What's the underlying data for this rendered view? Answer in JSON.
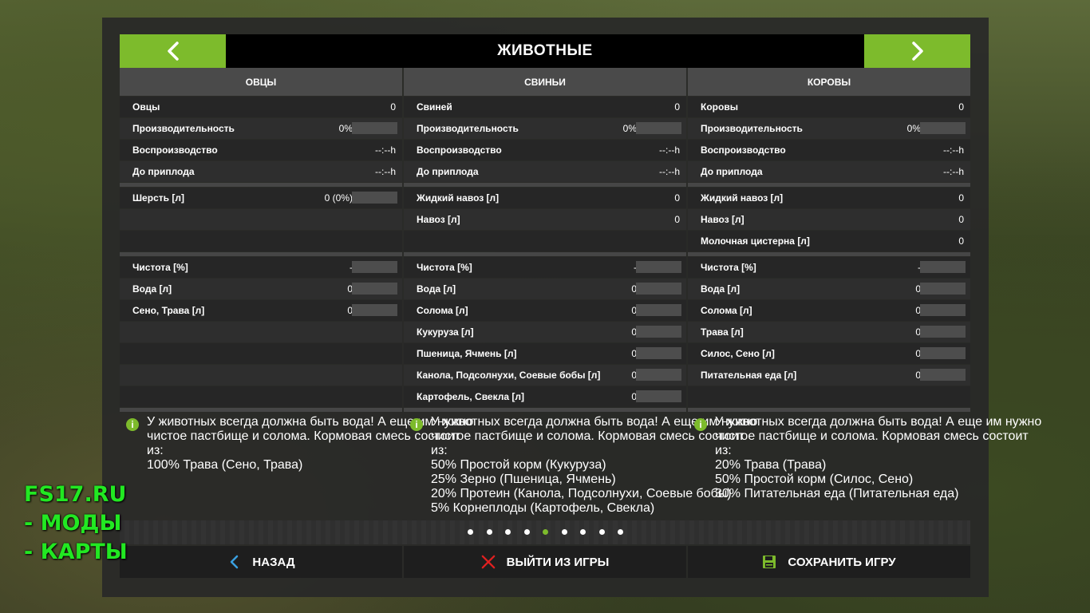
{
  "header": {
    "title": "ЖИВОТНЫЕ"
  },
  "columns": [
    {
      "name": "ОВЦЫ",
      "stats": [
        {
          "label": "Овцы",
          "value": "0",
          "bar": false
        },
        {
          "label": "Производительность",
          "value": "0%",
          "bar": true
        },
        {
          "label": "Воспроизводство",
          "value": "--:--h",
          "bar": false
        },
        {
          "label": "До приплода",
          "value": "--:--h",
          "bar": false
        }
      ],
      "products": [
        {
          "label": "Шерсть [л]",
          "value": "0 (0%)",
          "bar": true
        },
        {
          "label": "",
          "value": "",
          "bar": false
        },
        {
          "label": "",
          "value": "",
          "bar": false
        }
      ],
      "needs": [
        {
          "label": "Чистота [%]",
          "value": "-",
          "bar": true
        },
        {
          "label": "Вода [л]",
          "value": "0",
          "bar": true
        },
        {
          "label": "Сено, Трава [л]",
          "value": "0",
          "bar": true
        },
        {
          "label": "",
          "value": "",
          "bar": false
        },
        {
          "label": "",
          "value": "",
          "bar": false
        },
        {
          "label": "",
          "value": "",
          "bar": false
        },
        {
          "label": "",
          "value": "",
          "bar": false
        }
      ],
      "info": [
        "У животных всегда должна быть вода! А еще им нужно",
        "чистое пастбище и солома. Кормовая смесь состоит",
        "из:",
        "100% Трава (Сено, Трава)"
      ]
    },
    {
      "name": "СВИНЬИ",
      "stats": [
        {
          "label": "Свиней",
          "value": "0",
          "bar": false
        },
        {
          "label": "Производительность",
          "value": "0%",
          "bar": true
        },
        {
          "label": "Воспроизводство",
          "value": "--:--h",
          "bar": false
        },
        {
          "label": "До приплода",
          "value": "--:--h",
          "bar": false
        }
      ],
      "products": [
        {
          "label": "Жидкий навоз [л]",
          "value": "0",
          "bar": false
        },
        {
          "label": "Навоз [л]",
          "value": "0",
          "bar": false
        },
        {
          "label": "",
          "value": "",
          "bar": false
        }
      ],
      "needs": [
        {
          "label": "Чистота [%]",
          "value": "-",
          "bar": true
        },
        {
          "label": "Вода [л]",
          "value": "0",
          "bar": true
        },
        {
          "label": "Солома [л]",
          "value": "0",
          "bar": true
        },
        {
          "label": "Кукуруза [л]",
          "value": "0",
          "bar": true
        },
        {
          "label": "Пшеница, Ячмень [л]",
          "value": "0",
          "bar": true
        },
        {
          "label": "Канола, Подсолнухи, Соевые бобы [л]",
          "value": "0",
          "bar": true
        },
        {
          "label": "Картофель, Свекла [л]",
          "value": "0",
          "bar": true
        }
      ],
      "info": [
        "У животных всегда должна быть вода! А еще им нужно",
        "чистое пастбище и солома. Кормовая смесь состоит",
        "из:",
        "50% Простой корм (Кукуруза)",
        "25% Зерно (Пшеница, Ячмень)",
        "20% Протеин (Канола, Подсолнухи, Соевые бобы)",
        "5% Корнеплоды (Картофель, Свекла)"
      ]
    },
    {
      "name": "КОРОВЫ",
      "stats": [
        {
          "label": "Коровы",
          "value": "0",
          "bar": false
        },
        {
          "label": "Производительность",
          "value": "0%",
          "bar": true
        },
        {
          "label": "Воспроизводство",
          "value": "--:--h",
          "bar": false
        },
        {
          "label": "До приплода",
          "value": "--:--h",
          "bar": false
        }
      ],
      "products": [
        {
          "label": "Жидкий навоз [л]",
          "value": "0",
          "bar": false
        },
        {
          "label": "Навоз [л]",
          "value": "0",
          "bar": false
        },
        {
          "label": "Молочная цистерна [л]",
          "value": "0",
          "bar": false
        }
      ],
      "needs": [
        {
          "label": "Чистота [%]",
          "value": "-",
          "bar": true
        },
        {
          "label": "Вода [л]",
          "value": "0",
          "bar": true
        },
        {
          "label": "Солома [л]",
          "value": "0",
          "bar": true
        },
        {
          "label": "Трава [л]",
          "value": "0",
          "bar": true
        },
        {
          "label": "Силос, Сено [л]",
          "value": "0",
          "bar": true
        },
        {
          "label": "Питательная еда [л]",
          "value": "0",
          "bar": true
        },
        {
          "label": "",
          "value": "",
          "bar": false
        }
      ],
      "info": [
        "У животных всегда должна быть вода! А еще им нужно",
        "чистое пастбище и солома. Кормовая смесь состоит",
        "из:",
        "20% Трава (Трава)",
        "50% Простой корм (Силос, Сено)",
        "30% Питательная еда (Питательная еда)"
      ]
    }
  ],
  "pagination": {
    "count": 9,
    "active": 4
  },
  "footer": {
    "back_label": "НАЗАД",
    "quit_label": "ВЫЙТИ ИЗ ИГРЫ",
    "save_label": "СОХРАНИТЬ ИГРУ"
  },
  "watermark": {
    "line1": "FS17.RU",
    "line2": "- МОДЫ",
    "line3": "- КАРТЫ"
  },
  "colors": {
    "accent": "#7dbb2c",
    "watermark": "#22e822",
    "quit_icon": "#e02020"
  },
  "icons": {
    "prev": "chevron-left-icon",
    "next": "chevron-right-icon",
    "info": "info-icon",
    "back": "back-arrow-icon",
    "quit": "close-x-icon",
    "save": "floppy-disk-icon"
  }
}
